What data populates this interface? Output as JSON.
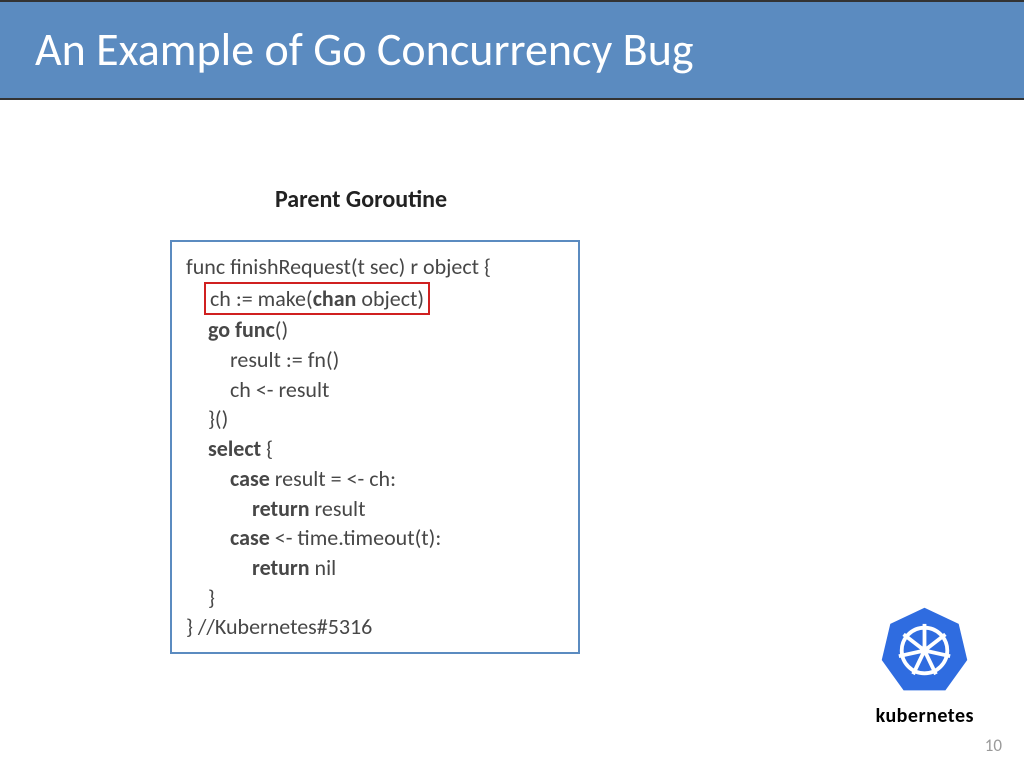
{
  "title": "An Example of Go Concurrency Bug",
  "subtitle": "Parent Goroutine",
  "code": {
    "line1": "func finishRequest(t sec) r object {",
    "line2_pre": "ch := make(",
    "line2_bold": "chan",
    "line2_post": " object)",
    "line3_bold": "go func",
    "line3_rest": "()",
    "line4": "result := fn()",
    "line5": "ch <- result",
    "line6": "}()",
    "line7_bold": "select",
    "line7_rest": " {",
    "line8_bold": "case",
    "line8_rest": " result = <- ch:",
    "line9_bold": "return",
    "line9_rest": " result",
    "line10_bold": "case",
    "line10_rest": " <- time.timeout(t):",
    "line11_bold": "return",
    "line11_rest": " nil",
    "line12": "}",
    "line13": "} //Kubernetes#5316"
  },
  "logo_text": "kubernetes",
  "page_number": "10",
  "colors": {
    "title_bg": "#5b8bc0",
    "border_blue": "#5b8bc0",
    "highlight_red": "#d02020",
    "logo_blue": "#2f6ce0"
  }
}
